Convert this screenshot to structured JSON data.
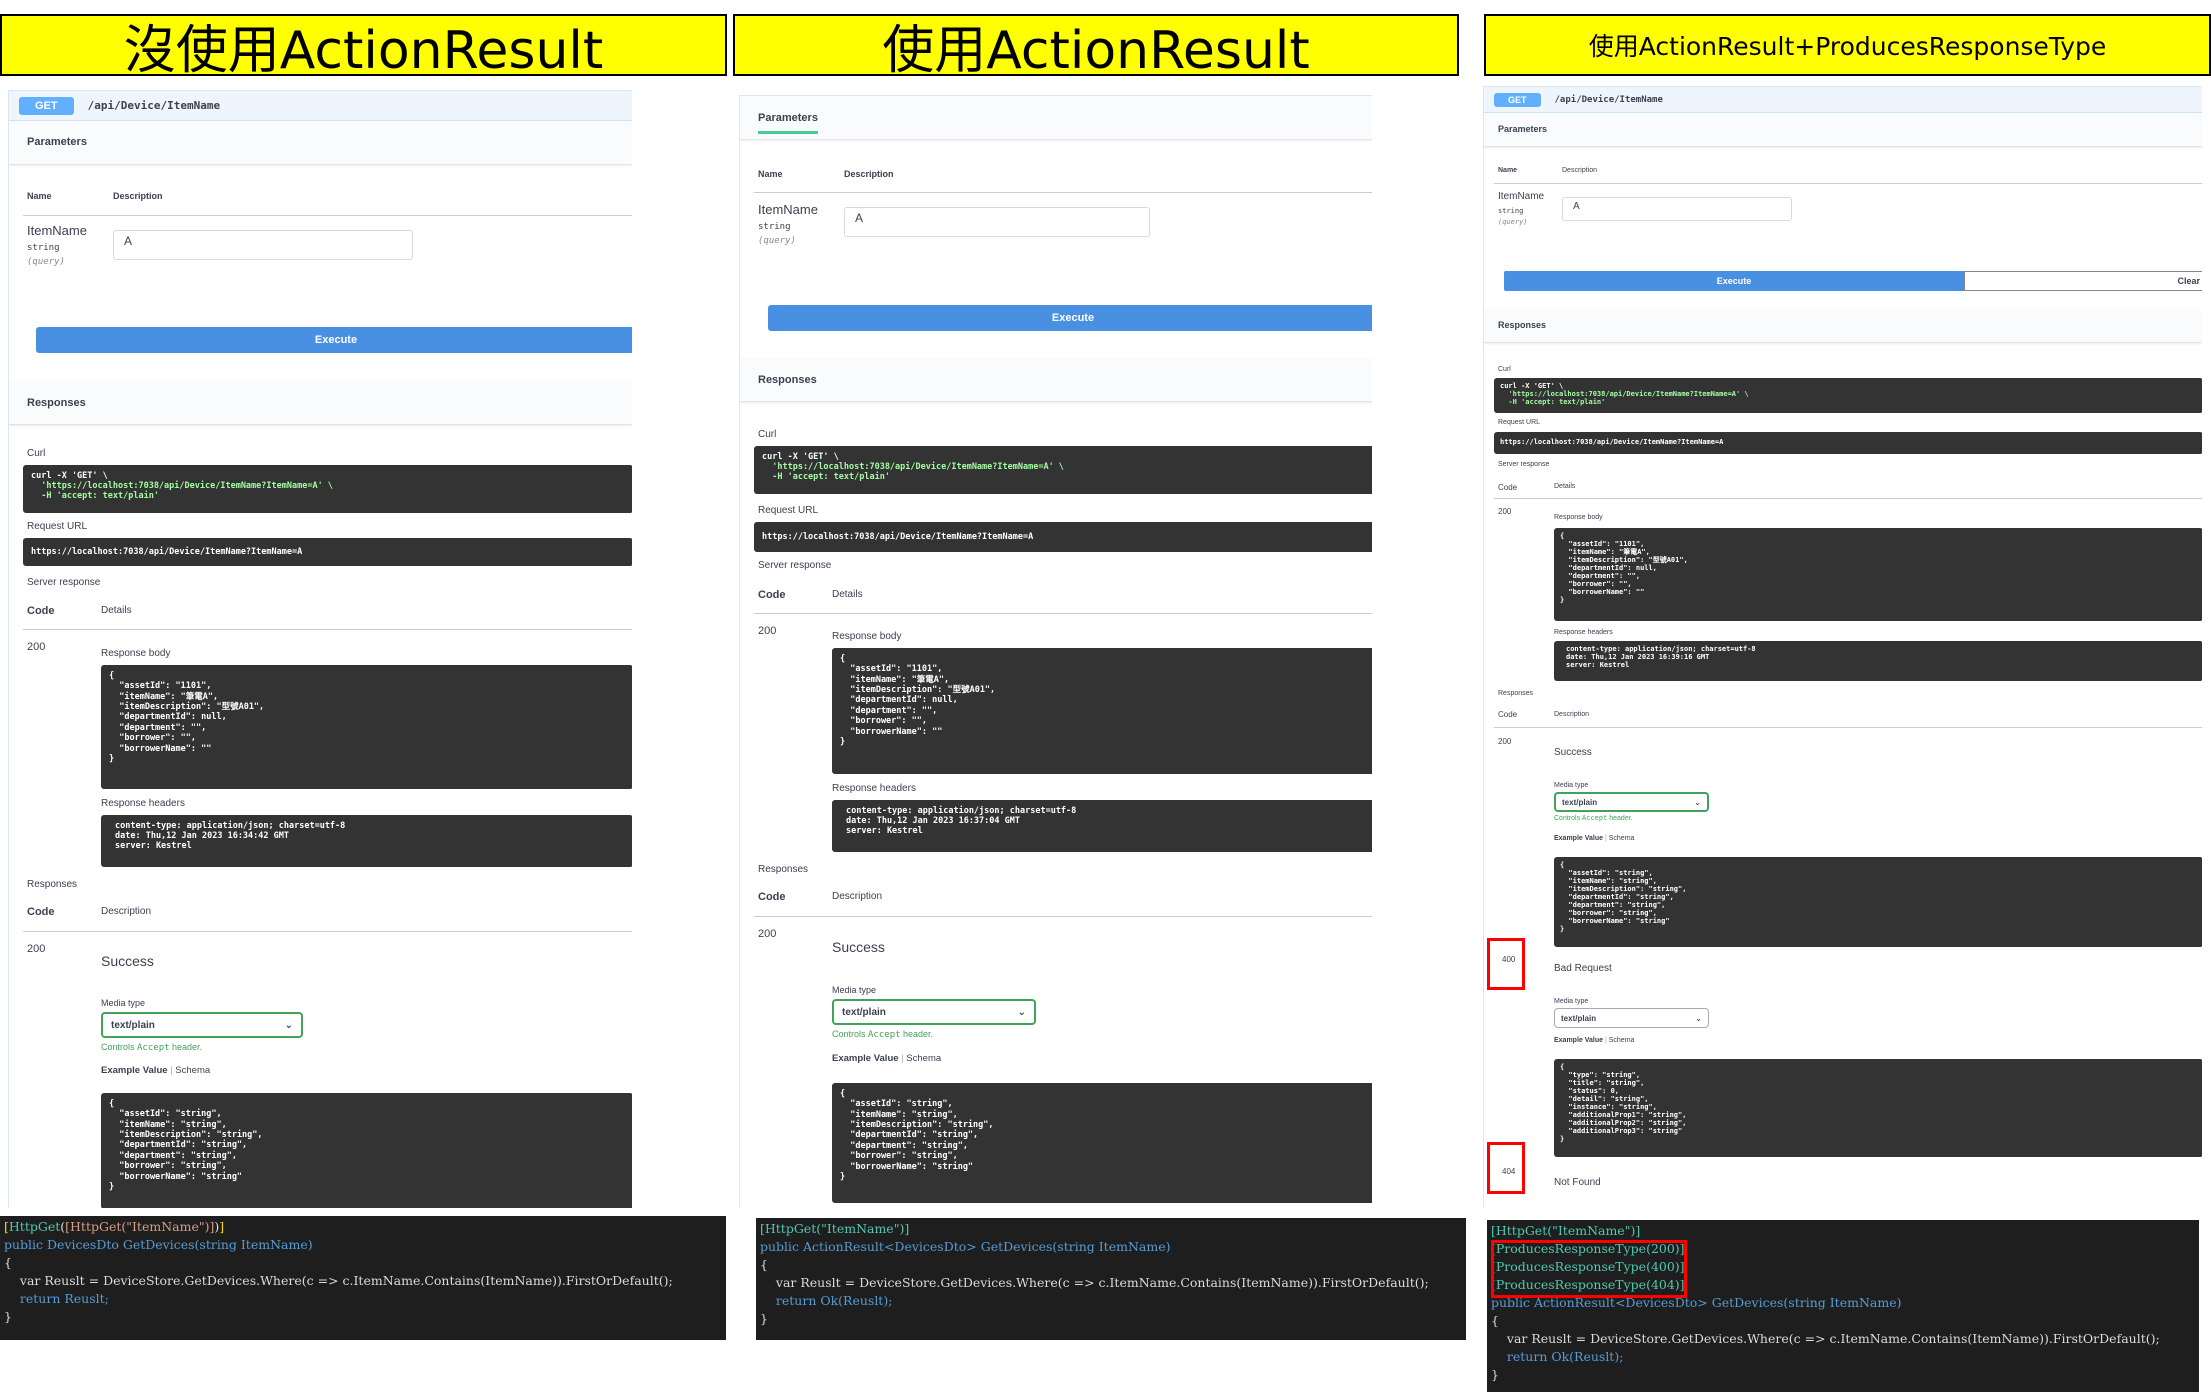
{
  "titles": [
    "沒使用ActionResult",
    "使用ActionResult",
    "使用ActionResult+ProducesResponseType"
  ],
  "swagger": {
    "method": "GET",
    "path": "/api/Device/ItemName",
    "parameters_tab": "Parameters",
    "col_name": "Name",
    "col_description": "Description",
    "param_name": "ItemName",
    "param_type": "string",
    "param_in": "(query)",
    "param_value": "A",
    "execute": "Execute",
    "clear": "Clear",
    "responses": "Responses",
    "curl_label": "Curl",
    "curl_lines": [
      "curl -X 'GET' \\",
      "  'https://localhost:7038/api/Device/ItemName?ItemName=A' \\",
      "  -H 'accept: text/plain'"
    ],
    "request_url_label": "Request URL",
    "request_url": "https://localhost:7038/api/Device/ItemName?ItemName=A",
    "server_response": "Server response",
    "code": "Code",
    "details": "Details",
    "status_200": "200",
    "response_body_label": "Response body",
    "response_body": "{\n  \"assetId\": \"1101\",\n  \"itemName\": \"筆電A\",\n  \"itemDescription\": \"型號A01\",\n  \"departmentId\": null,\n  \"department\": \"\",\n  \"borrower\": \"\",\n  \"borrowerName\": \"\"\n}",
    "response_headers_label": "Response headers",
    "headers": [
      "content-type: application/json; charset=utf-8",
      "date: Thu,12 Jan 2023 16:34:42 GMT",
      "date: Thu,12 Jan 2023 16:37:04 GMT",
      "date: Thu,12 Jan 2023 16:39:16 GMT",
      "server: Kestrel"
    ],
    "responses_label": "Responses",
    "description": "Description",
    "success": "Success",
    "media_type_label": "Media type",
    "media_type": "text/plain",
    "controls_pre": "Controls ",
    "controls_accept": "Accept",
    "controls_post": " header.",
    "example_value": "Example Value",
    "schema": "Schema",
    "example_body": "{\n  \"assetId\": \"string\",\n  \"itemName\": \"string\",\n  \"itemDescription\": \"string\",\n  \"departmentId\": \"string\",\n  \"department\": \"string\",\n  \"borrower\": \"string\",\n  \"borrowerName\": \"string\"\n}",
    "status_400": "400",
    "bad_request": "Bad Request",
    "problem_body": "{\n  \"type\": \"string\",\n  \"title\": \"string\",\n  \"status\": 0,\n  \"detail\": \"string\",\n  \"instance\": \"string\",\n  \"additionalProp1\": \"string\",\n  \"additionalProp2\": \"string\",\n  \"additionalProp3\": \"string\"\n}",
    "status_404": "404",
    "not_found": "Not Found"
  },
  "code": {
    "http_get": "[HttpGet(\"ItemName\")]",
    "sig1": "public DevicesDto GetDevices(string ItemName)",
    "sig2": "public ActionResult<DevicesDto> GetDevices(string ItemName)",
    "pr200": "[ProducesResponseType(200)]",
    "pr400": "[ProducesResponseType(400)]",
    "pr404": "[ProducesResponseType(404)]",
    "open": "{",
    "body": "    var Reuslt = DeviceStore.GetDevices.Where(c => c.ItemName.Contains(ItemName)).FirstOrDefault();",
    "ret1": "    return Reuslt;",
    "ret2": "    return Ok(Reuslt);",
    "close": "}"
  }
}
